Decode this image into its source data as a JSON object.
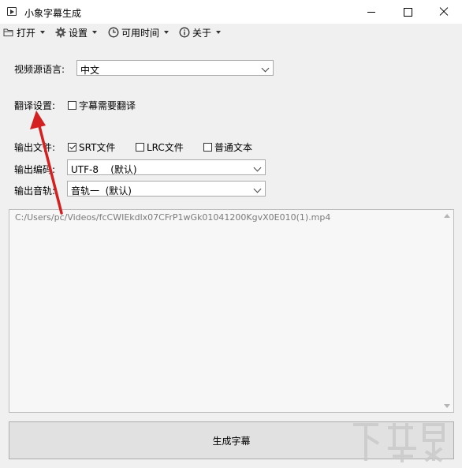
{
  "window": {
    "title": "小象字幕生成"
  },
  "menu": {
    "open_label": "打开",
    "settings_label": "设置",
    "time_label": "可用时间",
    "about_label": "关于"
  },
  "form": {
    "source_language_label": "视频源语言:",
    "source_language_value": "中文",
    "translation_label": "翻译设置:",
    "translation_checkbox_label": "字幕需要翻译",
    "translation_checked": false,
    "output_file_label": "输出文件:",
    "srt_label": "SRT文件",
    "srt_checked": true,
    "lrc_label": "LRC文件",
    "lrc_checked": false,
    "plain_text_label": "普通文本",
    "plain_text_checked": false,
    "output_encoding_label": "输出编码:",
    "output_encoding_value": "UTF-8    (默认)",
    "output_track_label": "输出音轨:",
    "output_track_value": "音轨一  (默认)"
  },
  "file_list": {
    "items": [
      "C:/Users/pc/Videos/fcCWIEkdlx07CFrP1wGk01041200KgvX0E010(1).mp4"
    ]
  },
  "generate_button_label": "生成字幕",
  "watermark": {
    "text": "下载吧"
  },
  "colors": {
    "annotation_arrow": "#d42020",
    "background": "#f0f0f0"
  }
}
